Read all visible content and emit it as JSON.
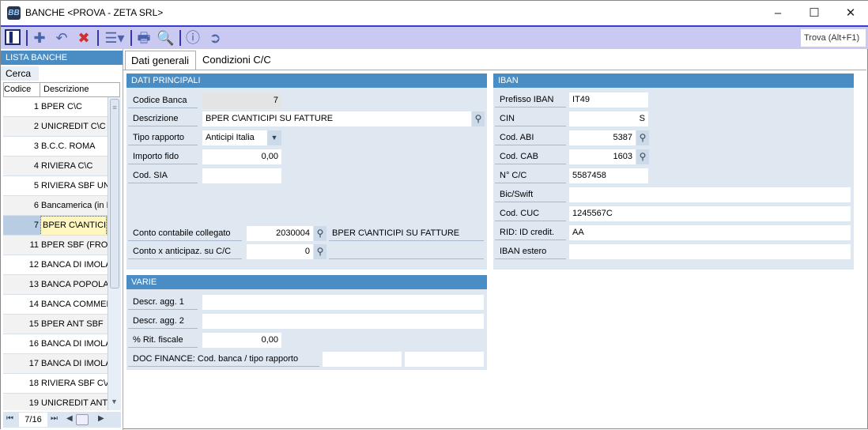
{
  "window": {
    "title": "BANCHE <PROVA - ZETA SRL>",
    "icon_text": "BB"
  },
  "toolbar": {
    "search_label": "Trova (Alt+F1)"
  },
  "left": {
    "header": "LISTA BANCHE",
    "search_label": "Cerca",
    "col_code": "Codice",
    "col_desc": "Descrizione",
    "pager": "7/16",
    "rows": [
      {
        "code": "1",
        "desc": "BPER C\\C"
      },
      {
        "code": "2",
        "desc": "UNICREDIT C\\C"
      },
      {
        "code": "3",
        "desc": "B.C.C. ROMA"
      },
      {
        "code": "4",
        "desc": " RIVIERA C\\C"
      },
      {
        "code": "5",
        "desc": "RIVIERA SBF UNI"
      },
      {
        "code": "6",
        "desc": "Bancamerica (in I"
      },
      {
        "code": "7",
        "desc": "BPER C\\ANTICIP",
        "selected": true
      },
      {
        "code": "11",
        "desc": "BPER SBF (FRON"
      },
      {
        "code": "12",
        "desc": "BANCA DI IMOLA"
      },
      {
        "code": "13",
        "desc": "BANCA POPOLAR"
      },
      {
        "code": "14",
        "desc": "BANCA COMMER"
      },
      {
        "code": "15",
        "desc": "BPER  ANT SBF"
      },
      {
        "code": "16",
        "desc": "BANCA DI IMOLA"
      },
      {
        "code": "17",
        "desc": "BANCA DI IMOLA"
      },
      {
        "code": "18",
        "desc": "RIVIERA SBF C\\A"
      },
      {
        "code": "19",
        "desc": "UNICREDIT ANTI"
      }
    ]
  },
  "tabs": [
    {
      "label": "Dati generali",
      "active": true
    },
    {
      "label": "Condizioni C/C"
    }
  ],
  "dati": {
    "header": "DATI PRINCIPALI",
    "codice_banca": {
      "label": "Codice Banca",
      "value": "7"
    },
    "descrizione": {
      "label": "Descrizione",
      "value": "BPER C\\ANTICIPI SU FATTURE"
    },
    "tipo_rapporto": {
      "label": "Tipo rapporto",
      "value": "Anticipi Italia"
    },
    "importo_fido": {
      "label": "Importo fido",
      "value": "0,00"
    },
    "cod_sia": {
      "label": "Cod. SIA",
      "value": ""
    },
    "conto_collegato": {
      "label": "Conto contabile collegato",
      "value": "2030004",
      "desc": "BPER C\\ANTICIPI SU FATTURE"
    },
    "conto_anticipaz": {
      "label": "Conto x anticipaz. su C/C",
      "value": "0",
      "desc": ""
    }
  },
  "iban": {
    "header": "IBAN",
    "prefisso": {
      "label": "Prefisso IBAN",
      "value": "IT49"
    },
    "cin": {
      "label": "CIN",
      "value": "S"
    },
    "abi": {
      "label": "Cod. ABI",
      "value": "5387"
    },
    "cab": {
      "label": "Cod. CAB",
      "value": "1603"
    },
    "cc": {
      "label": "N° C/C",
      "value": "5587458"
    },
    "bic": {
      "label": "Bic/Swift",
      "value": ""
    },
    "cuc": {
      "label": "Cod. CUC",
      "value": "1245567C"
    },
    "rid": {
      "label": "RID: ID credit.",
      "value": "AA"
    },
    "estero": {
      "label": "IBAN estero",
      "value": ""
    }
  },
  "varie": {
    "header": "VARIE",
    "agg1": {
      "label": "Descr. agg. 1",
      "value": ""
    },
    "agg2": {
      "label": "Descr. agg. 2",
      "value": ""
    },
    "rit": {
      "label": "% Rit. fiscale",
      "value": "0,00"
    },
    "docfin": {
      "label": "DOC FINANCE: Cod. banca / tipo rapporto",
      "value1": "",
      "value2": ""
    }
  }
}
